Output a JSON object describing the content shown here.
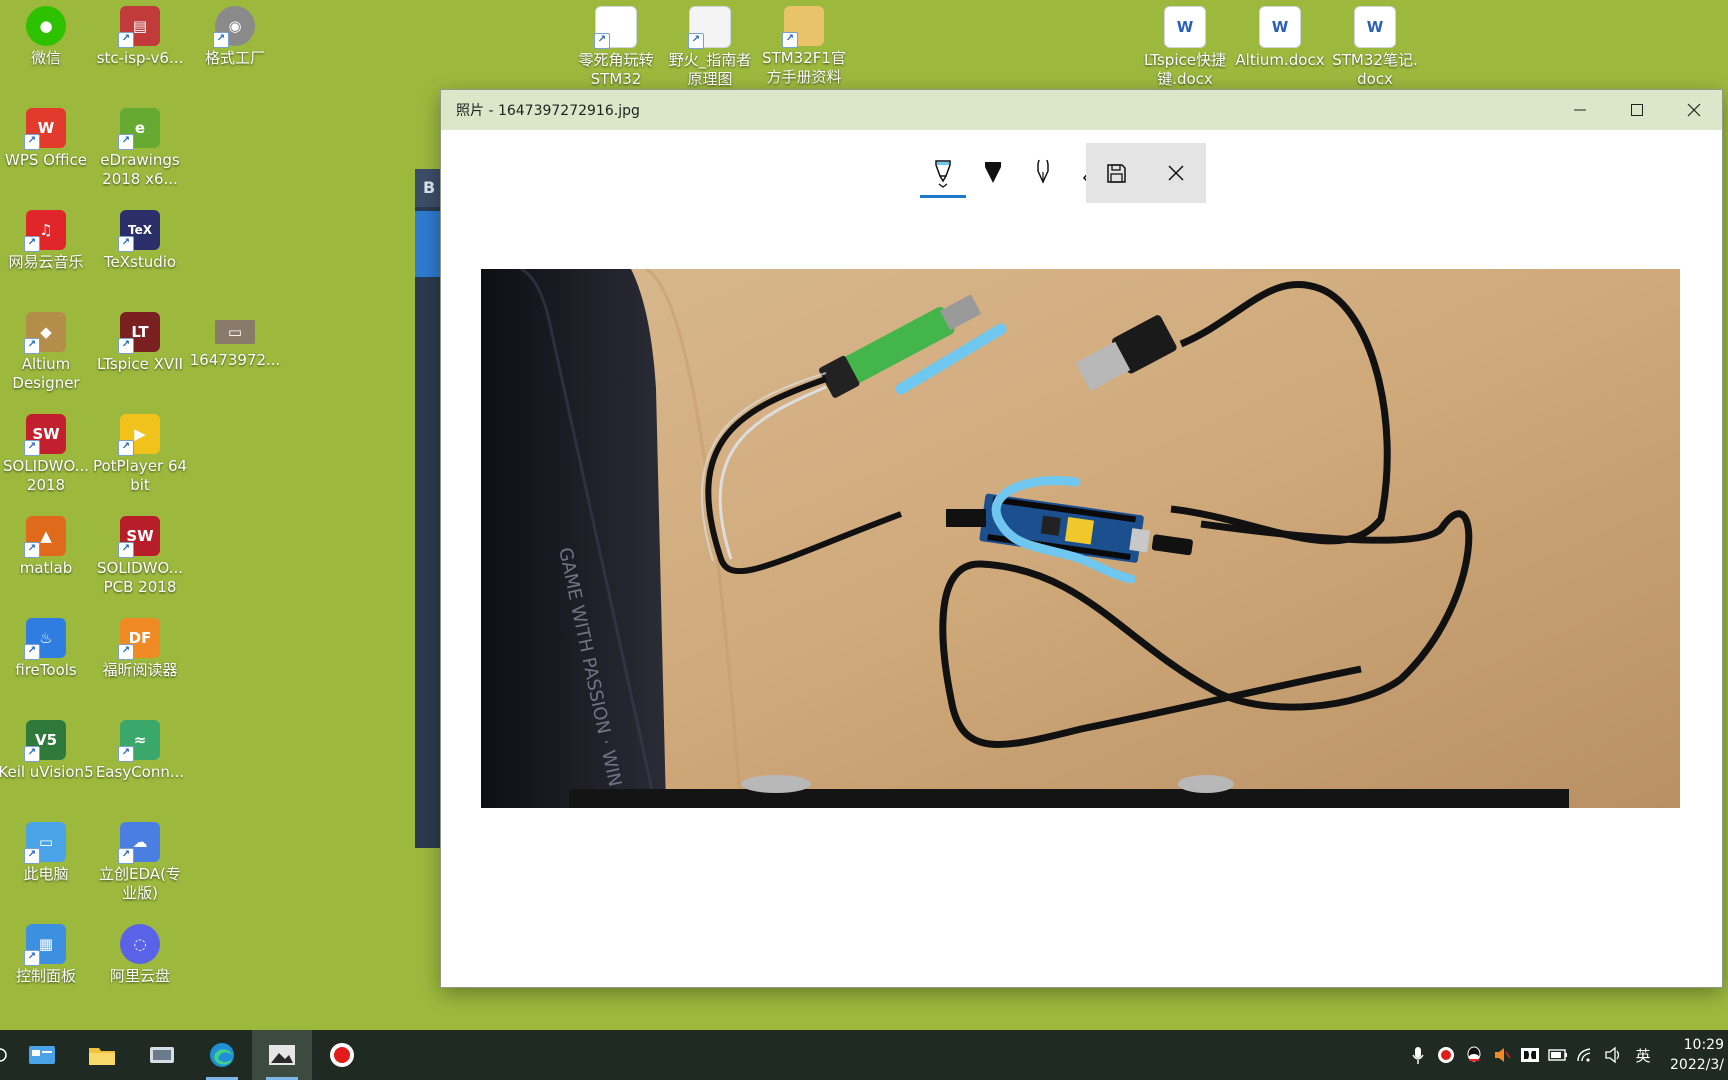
{
  "desktop": {
    "icons": [
      {
        "label": "微信",
        "color": "#2dc100",
        "glyph": "●"
      },
      {
        "label": "stc-isp-v6...",
        "color": "#c23b3b",
        "glyph": "▤"
      },
      {
        "label": "格式工厂",
        "color": "#8a8a8a",
        "glyph": "◉"
      },
      {
        "label": "WPS Office",
        "color": "#e23b2e",
        "glyph": "W"
      },
      {
        "label": "eDrawings 2018 x6...",
        "color": "#66aa33",
        "glyph": "e"
      },
      {
        "label": "网易云音乐",
        "color": "#e0262a",
        "glyph": "♫"
      },
      {
        "label": "TeXstudio",
        "color": "#2a2f6a",
        "glyph": "TeX"
      },
      {
        "label": "Altium Designer",
        "color": "#b58d4a",
        "glyph": "◆"
      },
      {
        "label": "LTspice XVII",
        "color": "#7a2020",
        "glyph": "LT"
      },
      {
        "label": "16473972...",
        "color": "#8a7a6a",
        "glyph": "▭"
      },
      {
        "label": "SOLIDWO... 2018",
        "color": "#c21f2f",
        "glyph": "SW"
      },
      {
        "label": "PotPlayer 64 bit",
        "color": "#f2c21c",
        "glyph": "▶"
      },
      {
        "label": "matlab",
        "color": "#e06a1c",
        "glyph": "▲"
      },
      {
        "label": "SOLIDWO... PCB 2018",
        "color": "#b81e2a",
        "glyph": "SW"
      },
      {
        "label": "fireTools",
        "color": "#2f7de1",
        "glyph": "♨"
      },
      {
        "label": "福昕阅读器",
        "color": "#f08a24",
        "glyph": "DF"
      },
      {
        "label": "Keil uVision5",
        "color": "#2f7a3a",
        "glyph": "V5"
      },
      {
        "label": "EasyConn...",
        "color": "#3aa86a",
        "glyph": "≈"
      },
      {
        "label": "此电脑",
        "color": "#4aa3e6",
        "glyph": "▭"
      },
      {
        "label": "立创EDA(专业版)",
        "color": "#4a7ee0",
        "glyph": "☁"
      },
      {
        "label": "控制面板",
        "color": "#3d8fe0",
        "glyph": "▦"
      },
      {
        "label": "阿里云盘",
        "color": "#5a62e8",
        "glyph": "◌"
      }
    ],
    "top_icons": [
      {
        "label": "零死角玩转 STM32",
        "type": "doc"
      },
      {
        "label": "野火_指南者 原理图",
        "type": "doc"
      },
      {
        "label": "STM32F1官 方手册资料",
        "type": "folder"
      },
      {
        "label": "LTspice快捷 键.docx",
        "type": "word"
      },
      {
        "label": "Altium.docx",
        "type": "word"
      },
      {
        "label": "STM32笔记. docx",
        "type": "word"
      }
    ]
  },
  "background_window": {
    "title_initial": "B"
  },
  "photos_window": {
    "title": "照片 - 1647397272916.jpg",
    "controls": {
      "minimize": "minimize",
      "maximize": "maximize",
      "close": "close"
    },
    "toolbar": {
      "tools": [
        "ballpoint-pen",
        "pencil",
        "calligraphy-pen",
        "eraser"
      ],
      "selected": "ballpoint-pen",
      "save": "save",
      "close": "close"
    }
  },
  "taskbar": {
    "apps": [
      "search",
      "file-manager",
      "explorer",
      "control",
      "edge",
      "photos",
      "recorder"
    ],
    "active": "photos",
    "tray": {
      "ime": "英",
      "time": "10:29",
      "date": "2022/3/"
    }
  },
  "colors": {
    "desktop": "#9cb93e",
    "titlebar": "#dae8c9",
    "accent": "#1f78c8",
    "ink": "#6fc7ef"
  }
}
